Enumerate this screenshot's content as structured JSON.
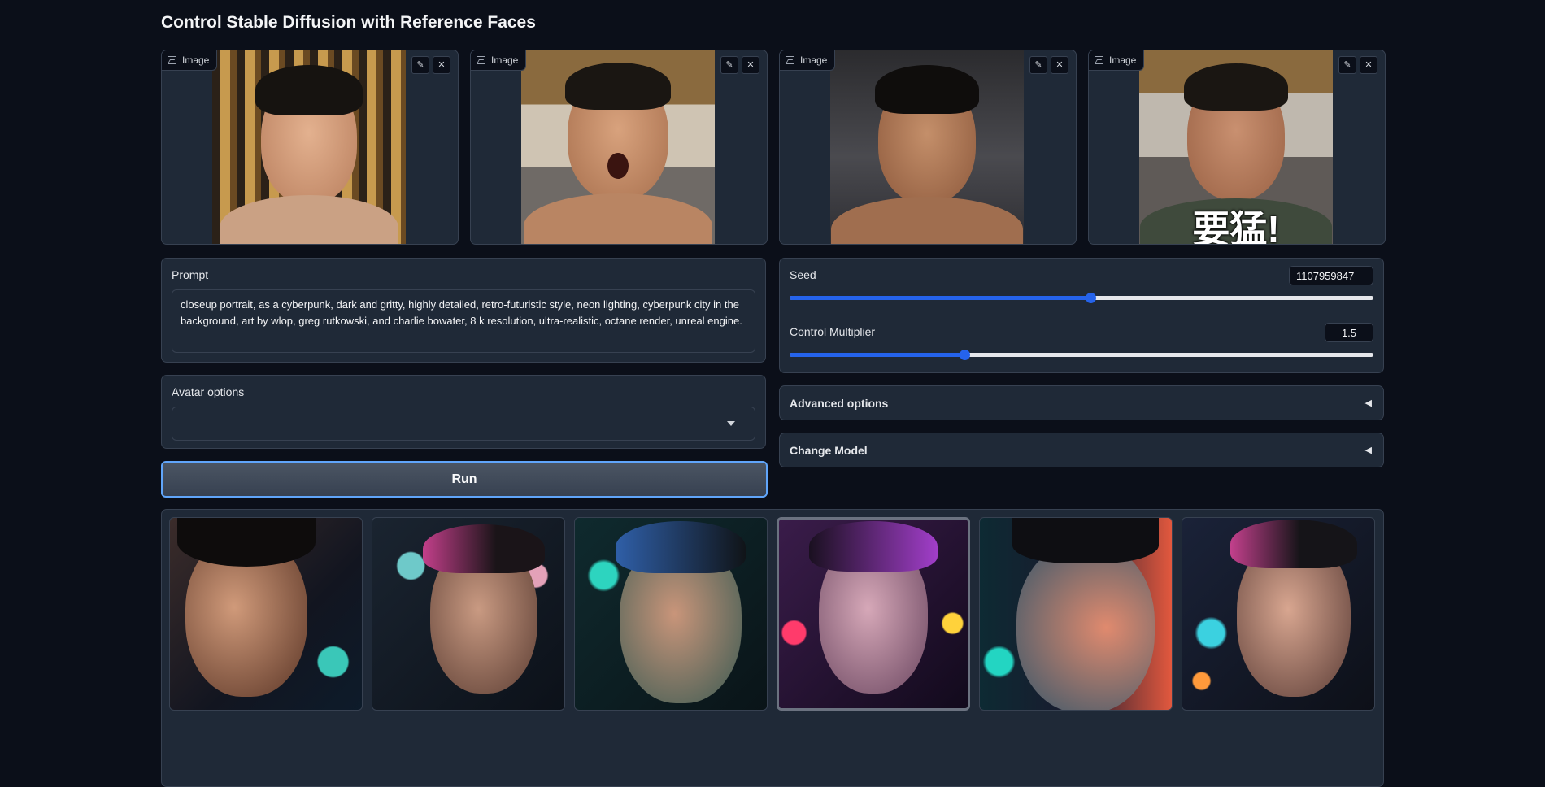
{
  "page": {
    "title": "Control Stable Diffusion with Reference Faces"
  },
  "reference_images": [
    {
      "label": "Image"
    },
    {
      "label": "Image"
    },
    {
      "label": "Image"
    },
    {
      "label": "Image",
      "caption": "要猛!"
    }
  ],
  "prompt": {
    "label": "Prompt",
    "value": "closeup portrait, as a cyberpunk, dark and gritty, highly detailed, retro-futuristic style, neon lighting, cyberpunk city in the background, art by wlop, greg rutkowski, and charlie bowater, 8 k resolution, ultra-realistic, octane render, unreal engine."
  },
  "avatar_options": {
    "label": "Avatar options",
    "value": ""
  },
  "run_button": {
    "label": "Run"
  },
  "seed": {
    "label": "Seed",
    "value": "1107959847",
    "fraction": 0.516
  },
  "control_multiplier": {
    "label": "Control Multiplier",
    "value": "1.5",
    "fraction": 0.3
  },
  "advanced_options": {
    "label": "Advanced options",
    "icon": "triangle-left-icon"
  },
  "change_model": {
    "label": "Change Model",
    "icon": "triangle-left-icon"
  },
  "gallery": {
    "count": 6,
    "selected_index": 3
  },
  "colors": {
    "background": "#0b0f19",
    "panel": "#1f2937",
    "border": "#374151",
    "accent": "#2563eb",
    "focus": "#60a5fa"
  }
}
